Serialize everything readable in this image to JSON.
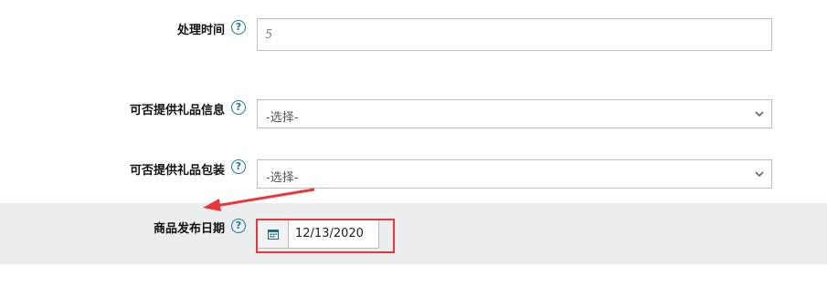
{
  "form": {
    "processing_time": {
      "label": "处理时间",
      "placeholder": "5",
      "value": ""
    },
    "gift_message": {
      "label": "可否提供礼品信息",
      "selected": "-选择-"
    },
    "gift_wrap": {
      "label": "可否提供礼品包装",
      "selected": "-选择-"
    },
    "release_date": {
      "label": "商品发布日期",
      "value": "12/13/2020"
    },
    "help_glyph": "?"
  },
  "icons": {
    "help": "question-circle-icon",
    "calendar": "calendar-icon",
    "dropdown": "chevron-down-icon"
  },
  "colors": {
    "help_icon": "#1a7a8e",
    "highlight": "#e8383c",
    "band_background": "#ecedee",
    "border": "#bdbdbd"
  }
}
